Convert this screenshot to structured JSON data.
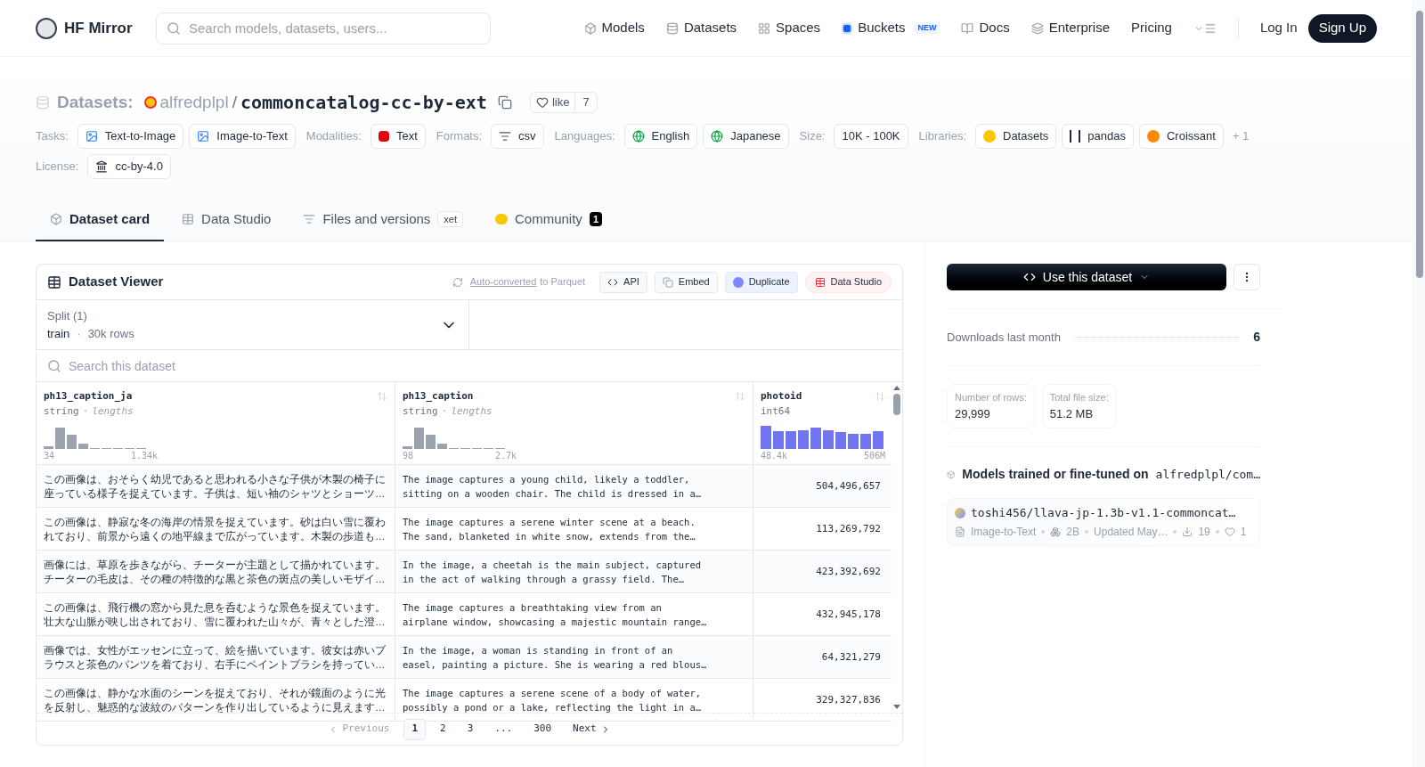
{
  "nav": {
    "brand": "HF Mirror",
    "search_placeholder": "Search models, datasets, users...",
    "links": [
      {
        "label": "Models"
      },
      {
        "label": "Datasets"
      },
      {
        "label": "Spaces"
      },
      {
        "label": "Buckets",
        "badge": "NEW"
      },
      {
        "label": "Docs"
      },
      {
        "label": "Enterprise"
      },
      {
        "label": "Pricing"
      }
    ],
    "login": "Log In",
    "signup": "Sign Up"
  },
  "header": {
    "section": "Datasets:",
    "owner": "alfredplpl",
    "slash": "/",
    "name": "commoncatalog-cc-by-ext",
    "like": "like",
    "likes": "7"
  },
  "tag_groups": [
    {
      "label": "Tasks:",
      "tags": [
        "Text-to-Image",
        "Image-to-Text"
      ]
    },
    {
      "label": "Modalities:",
      "tags": [
        "Text"
      ]
    },
    {
      "label": "Formats:",
      "tags": [
        "csv"
      ]
    },
    {
      "label": "Languages:",
      "tags": [
        "English",
        "Japanese"
      ]
    },
    {
      "label": "Size:",
      "tags": [
        "10K - 100K"
      ]
    },
    {
      "label": "Libraries:",
      "tags": [
        "Datasets",
        "pandas",
        "Croissant"
      ],
      "more": "+ 1"
    },
    {
      "label": "License:",
      "tags": [
        "cc-by-4.0"
      ]
    }
  ],
  "tabs": [
    {
      "label": "Dataset card",
      "selected": true
    },
    {
      "label": "Data Studio",
      "selected": false
    },
    {
      "label": "Files and versions",
      "selected": false,
      "badge": "xet"
    },
    {
      "label": "Community",
      "selected": false,
      "count": "1"
    }
  ],
  "viewer": {
    "title": "Dataset Viewer",
    "auto_link": "Auto-converted",
    "auto_rest": "to Parquet",
    "buttons": [
      "API",
      "Embed",
      "Duplicate",
      "Data Studio"
    ],
    "split_label": "Split (1)",
    "split": "train",
    "split_sep": "·",
    "split_rows": "30k rows",
    "search_placeholder": "Search this dataset",
    "columns": [
      {
        "name": "ph13_caption_ja",
        "type": "string",
        "sep": "·",
        "extra": "lengths",
        "min": "34",
        "max": "1.34k",
        "kind": "string"
      },
      {
        "name": "ph13_caption",
        "type": "string",
        "sep": "·",
        "extra": "lengths",
        "min": "98",
        "max": "2.7k",
        "kind": "string"
      },
      {
        "name": "photoid",
        "type": "int64",
        "min": "48.4k",
        "max": "506M",
        "kind": "number"
      }
    ],
    "rows": [
      [
        "この画像は、おそらく幼児であると思われる小さな子供が木製の椅子に座っている様子を捉えています。子供は、短い袖のシャツとショーツ…",
        "The image captures a young child, likely a toddler,\nsitting on a wooden chair. The child is dressed in a…",
        "504,496,657"
      ],
      [
        "この画像は、静寂な冬の海岸の情景を捉えています。砂は白い雪に覆われており、前景から遠くの地平線まで広がっています。木製の歩道も…",
        "The image captures a serene winter scene at a beach.\nThe sand, blanketed in white snow, extends from the…",
        "113,269,792"
      ],
      [
        "画像には、草原を歩きながら、チーターが主題として描かれています。チーターの毛皮は、その種の特徴的な黒と茶色の斑点の美しいモザイ…",
        "In the image, a cheetah is the main subject, captured\nin the act of walking through a grassy field. The…",
        "423,392,692"
      ],
      [
        "この画像は、飛行機の窓から見た息を呑むような景色を捉えています。壮大な山脈が映し出されており、雪に覆われた山々が、青々とした澄…",
        "The image captures a breathtaking view from an\nairplane window, showcasing a majestic mountain range…",
        "432,945,178"
      ],
      [
        "画像では、女性がエッセンに立って、絵を描いています。彼女は赤いブラウスと茶色のパンツを着ており、右手にペイントブラシを持ってい…",
        "In the image, a woman is standing in front of an\neasel, painting a picture. She is wearing a red blous…",
        "64,321,279"
      ],
      [
        "この画像は、静かな水面のシーンを捉えており、それが鏡面のように光を反射し、魅惑的な波紋のパターンを作り出しているように見えます…",
        "The image captures a serene scene of a body of water,\npossibly a pond or a lake, reflecting the light in a…",
        "329,327,836"
      ]
    ],
    "pages": [
      {
        "label": "1",
        "selected": true
      },
      {
        "label": "2",
        "selected": false
      },
      {
        "label": "3",
        "selected": false
      },
      {
        "label": "...",
        "selected": false
      },
      {
        "label": "300",
        "selected": false
      }
    ],
    "prev": "Previous",
    "next": "Next"
  },
  "sidebar": {
    "use_button": "Use this dataset",
    "downloads_label": "Downloads last month",
    "downloads": "6",
    "stats": [
      {
        "label": "Number of rows:",
        "value": "29,999"
      },
      {
        "label": "Total file size:",
        "value": "51.2 MB"
      }
    ],
    "models_title": "Models trained or fine-tuned on",
    "models_repo": "alfredplpl/com…",
    "model": {
      "name": "toshi456/llava-jp-1.3b-v1.1-commoncat…",
      "task": "Image-to-Text",
      "params": "2B",
      "updated": "Updated May…",
      "downloads": "19",
      "likes": "1"
    }
  }
}
